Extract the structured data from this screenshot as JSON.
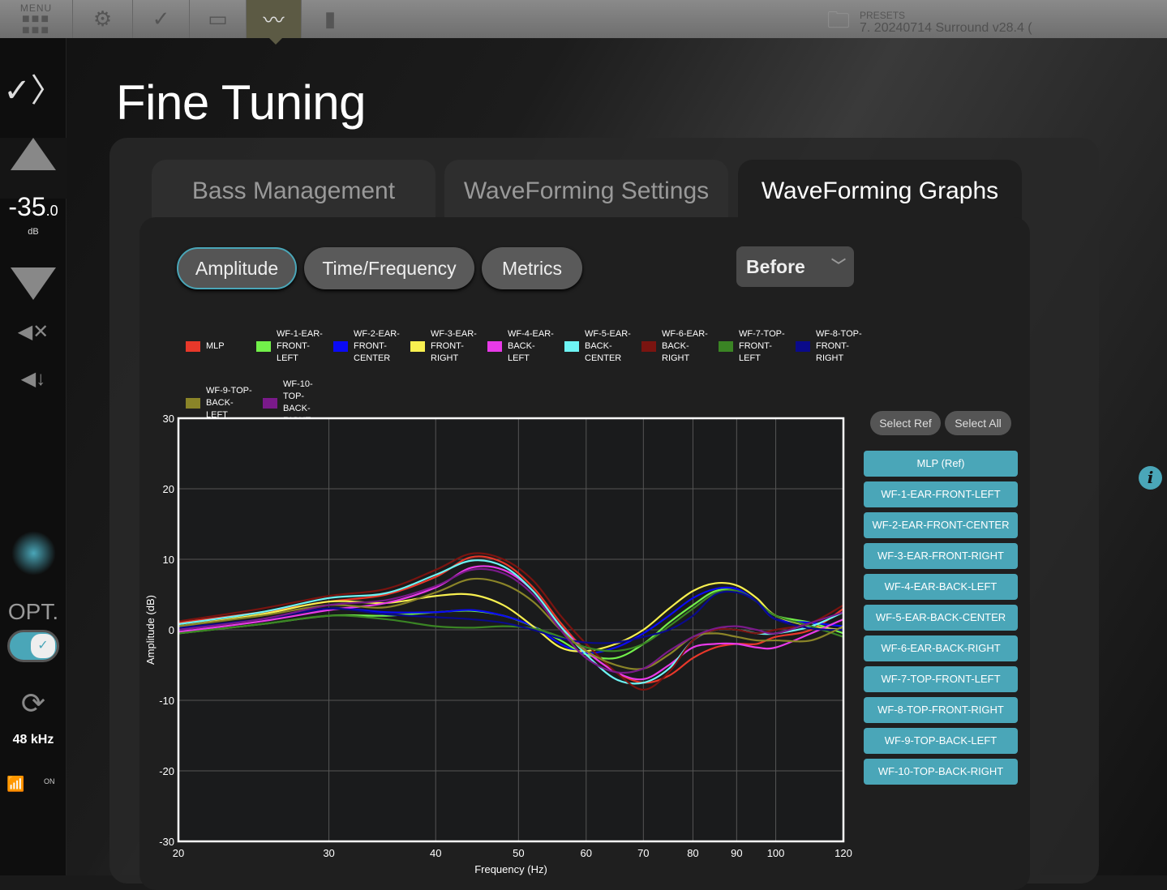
{
  "topbar": {
    "menu_label": "MENU",
    "presets_label": "PRESETS",
    "preset_value": "7. 20240714 Surround v28.4 ("
  },
  "sidebar": {
    "volume": "-35",
    "volume_decimal": ".0",
    "volume_unit": "dB",
    "input_label": "OPT.",
    "sample_rate": "48 kHz",
    "mic_status": "ON"
  },
  "page_title": "Fine Tuning",
  "tabs": [
    {
      "label": "Bass Management"
    },
    {
      "label": "WaveForming Settings"
    },
    {
      "label": "WaveForming Graphs"
    }
  ],
  "subtabs": [
    {
      "label": "Amplitude"
    },
    {
      "label": "Time/Frequency"
    },
    {
      "label": "Metrics"
    }
  ],
  "dropdown": {
    "value": "Before"
  },
  "select_ref": "Select Ref",
  "select_all": "Select All",
  "channel_buttons": [
    "MLP (Ref)",
    "WF-1-EAR-FRONT-LEFT",
    "WF-2-EAR-FRONT-CENTER",
    "WF-3-EAR-FRONT-RIGHT",
    "WF-4-EAR-BACK-LEFT",
    "WF-5-EAR-BACK-CENTER",
    "WF-6-EAR-BACK-RIGHT",
    "WF-7-TOP-FRONT-LEFT",
    "WF-8-TOP-FRONT-RIGHT",
    "WF-9-TOP-BACK-LEFT",
    "WF-10-TOP-BACK-RIGHT"
  ],
  "chart_data": {
    "type": "line",
    "xlabel": "Frequency (Hz)",
    "ylabel": "Amplitude (dB)",
    "xscale": "log",
    "xlim": [
      20,
      120
    ],
    "ylim": [
      -30,
      30
    ],
    "xticks": [
      20,
      30,
      40,
      50,
      60,
      70,
      80,
      90,
      100,
      120
    ],
    "yticks": [
      30,
      20,
      10,
      0,
      -10,
      -20,
      -30
    ],
    "grid": true,
    "legend_position": "top",
    "x": [
      20,
      25,
      30,
      35,
      40,
      44,
      48,
      52,
      56,
      60,
      65,
      70,
      75,
      80,
      85,
      90,
      95,
      100,
      110,
      120
    ],
    "series": [
      {
        "name": "MLP",
        "color": "#e8382a",
        "values": [
          1,
          2.5,
          4,
          5,
          7.5,
          10.3,
          9.5,
          6,
          1,
          -3,
          -6,
          -7.5,
          -6.5,
          -4,
          -2.5,
          -2,
          -2,
          -1,
          0,
          3
        ]
      },
      {
        "name": "WF-1-EAR-FRONT-LEFT",
        "color": "#72f04a",
        "values": [
          -0.5,
          0.8,
          2,
          2,
          2.5,
          2.7,
          2,
          0.5,
          -1.5,
          -3.5,
          -4,
          -2,
          1,
          3.5,
          5.5,
          5.5,
          4,
          2,
          1,
          -0.5
        ]
      },
      {
        "name": "WF-2-EAR-FRONT-CENTER",
        "color": "#0a0af5",
        "values": [
          0,
          1.5,
          3,
          2.5,
          2.5,
          2.8,
          2,
          0.5,
          -2,
          -3.3,
          -2.5,
          -0.5,
          2,
          4.5,
          5.8,
          5.8,
          4,
          1.5,
          1,
          0.5
        ]
      },
      {
        "name": "WF-3-EAR-FRONT-RIGHT",
        "color": "#f8f050",
        "values": [
          0.5,
          2.2,
          4,
          3.8,
          4.8,
          5,
          3.5,
          0.5,
          -2.5,
          -3,
          -2,
          0,
          3,
          5.5,
          6.6,
          6.3,
          4.5,
          2,
          0.5,
          0
        ]
      },
      {
        "name": "WF-4-EAR-BACK-LEFT",
        "color": "#e83ae8",
        "values": [
          -0.3,
          1.2,
          2.8,
          3.8,
          6,
          8.8,
          8.5,
          5.5,
          0.5,
          -3,
          -6,
          -7,
          -5,
          -2.5,
          -2,
          -2,
          -2.5,
          -2.5,
          -0.5,
          1.5
        ]
      },
      {
        "name": "WF-5-EAR-BACK-CENTER",
        "color": "#6ef4f4",
        "values": [
          0.8,
          2.5,
          4.5,
          5.2,
          7.8,
          9.8,
          9,
          5.5,
          0.5,
          -3.5,
          -7,
          -7.5,
          -5.5,
          -1.5,
          0,
          0,
          -0.5,
          -0.5,
          0.5,
          2.5
        ]
      },
      {
        "name": "WF-6-EAR-BACK-RIGHT",
        "color": "#7a1410",
        "values": [
          1.2,
          3,
          4.8,
          5.8,
          8.5,
          10.8,
          10,
          7,
          2,
          -2,
          -6,
          -8.5,
          -6,
          -1.5,
          0,
          0,
          -0.5,
          0,
          1,
          3.5
        ]
      },
      {
        "name": "WF-7-TOP-FRONT-LEFT",
        "color": "#3a8424",
        "values": [
          -0.5,
          0.8,
          2,
          1.5,
          0.5,
          0.3,
          0.5,
          0.2,
          -1,
          -2.5,
          -3,
          -2,
          0.5,
          3,
          5.2,
          5.5,
          4,
          2,
          0.5,
          -1
        ]
      },
      {
        "name": "WF-8-TOP-FRONT-RIGHT",
        "color": "#0a0a8a",
        "values": [
          0.3,
          1.5,
          3,
          2.2,
          1.8,
          1.5,
          1,
          0,
          -1.2,
          -1.8,
          -1.8,
          -1,
          0,
          2,
          5,
          5.3,
          4,
          1.5,
          0.2,
          0
        ]
      },
      {
        "name": "WF-9-TOP-BACK-LEFT",
        "color": "#8a8428",
        "values": [
          0.5,
          2,
          3.5,
          3.2,
          5.3,
          7.2,
          6.5,
          4,
          0,
          -3,
          -5,
          -5.5,
          -3.5,
          -1,
          -0.5,
          -1,
          -1.5,
          -1.5,
          -1.5,
          0.5
        ]
      },
      {
        "name": "WF-10-TOP-BACK-RIGHT",
        "color": "#7a1a8a",
        "values": [
          0,
          1.5,
          3.5,
          4.2,
          6.2,
          8.5,
          8,
          5,
          0,
          -4,
          -6,
          -5.5,
          -3,
          -1,
          0.2,
          0.5,
          0,
          -0.5,
          1,
          2.5
        ]
      }
    ]
  }
}
